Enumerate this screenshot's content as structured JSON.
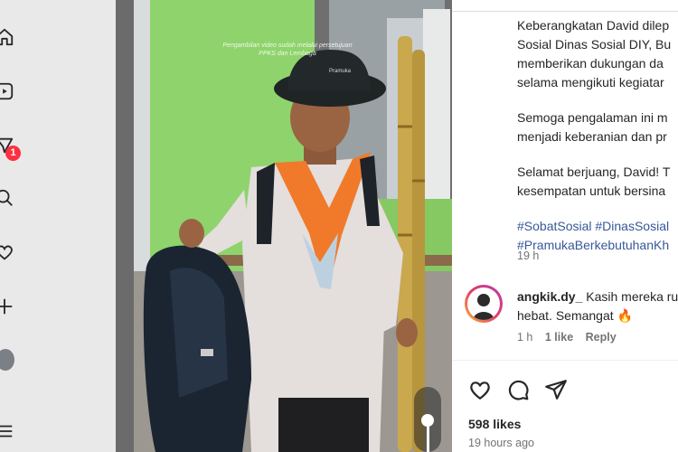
{
  "nav": {
    "items": [
      "home-icon",
      "reels-icon",
      "messages-icon",
      "search-icon",
      "notifications-icon",
      "create-icon",
      "profile-avatar"
    ],
    "messages_badge": "1"
  },
  "media": {
    "watermark_line1": "Pengambilan video sudah melalui persetujuan",
    "watermark_line2": "PPKS dan Lembaga",
    "hat_logo_text": "Pramuka"
  },
  "caption": {
    "line1": "Keberangkatan David dilep",
    "line2": "Sosial Dinas Sosial DIY, Bu",
    "line3": "memberikan dukungan da",
    "line4": "selama mengikuti kegiatar",
    "line5": "Semoga pengalaman ini m",
    "line6": "menjadi keberanian dan pr",
    "line7": "Selamat berjuang, David! T",
    "line8": "kesempatan untuk bersina",
    "hashtag_line1": "#SobatSosial #DinasSosial",
    "hashtag_line2": "#PramukaBerkebutuhanKh",
    "time": "19 h"
  },
  "comment": {
    "username": "angkik.dy_",
    "text_line1": " Kasih mereka ru",
    "text_line2": "hebat. Semangat 🔥",
    "time": "1 h",
    "likes": "1 like",
    "reply": "Reply"
  },
  "actions": [
    "like-icon",
    "comment-icon",
    "share-icon"
  ],
  "post": {
    "likes": "598 likes",
    "time": "19 hours ago"
  },
  "colors": {
    "hashtag": "#385898",
    "badge": "#ff3040",
    "scarf": "#f07a2a",
    "wall": "#8fd36c"
  }
}
